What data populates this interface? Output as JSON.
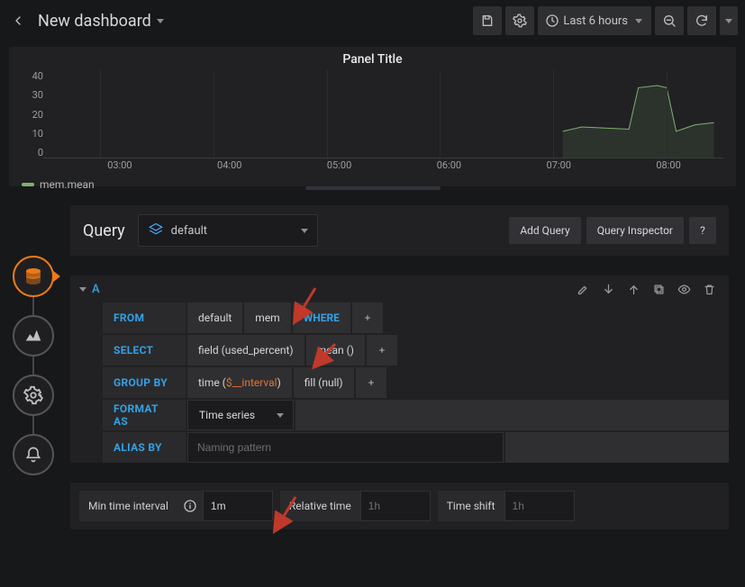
{
  "header": {
    "title": "New dashboard",
    "time_range": "Last 6 hours"
  },
  "panel": {
    "title": "Panel Title",
    "legend": "mem.mean"
  },
  "chart_data": {
    "type": "line",
    "title": "Panel Title",
    "xlabel": "",
    "ylabel": "",
    "ylim": [
      0,
      40
    ],
    "x_ticks": [
      "03:00",
      "04:00",
      "05:00",
      "06:00",
      "07:00",
      "08:00"
    ],
    "y_ticks": [
      0,
      10,
      20,
      30,
      40
    ],
    "series": [
      {
        "name": "mem.mean",
        "color": "#7eb26d",
        "x_range": [
          "02:30",
          "08:30"
        ],
        "points": [
          {
            "x": "07:05",
            "y": 12
          },
          {
            "x": "07:15",
            "y": 14
          },
          {
            "x": "07:40",
            "y": 13
          },
          {
            "x": "07:45",
            "y": 32
          },
          {
            "x": "07:55",
            "y": 33
          },
          {
            "x": "08:00",
            "y": 32
          },
          {
            "x": "08:05",
            "y": 12
          },
          {
            "x": "08:15",
            "y": 15
          },
          {
            "x": "08:25",
            "y": 16
          }
        ]
      }
    ]
  },
  "sidebar": {
    "items": [
      {
        "id": "datasource",
        "label": "datasource-icon"
      },
      {
        "id": "viz",
        "label": "visualization-icon"
      },
      {
        "id": "settings",
        "label": "panel-settings-icon"
      },
      {
        "id": "alert",
        "label": "alert-icon"
      }
    ]
  },
  "query_head": {
    "title": "Query",
    "datasource": "default",
    "add_query": "Add Query",
    "inspector": "Query Inspector",
    "help": "?"
  },
  "rows": [
    {
      "id": "A",
      "from": {
        "kw": "FROM",
        "policy": "default",
        "measurement": "mem",
        "where_kw": "WHERE"
      },
      "select": {
        "kw": "SELECT",
        "field": "field (used_percent)",
        "agg": "mean ()"
      },
      "group": {
        "kw": "GROUP BY",
        "time_pre": "time (",
        "time_var": "$__interval",
        "time_post": ")",
        "fill": "fill (null)"
      },
      "format": {
        "kw": "FORMAT AS",
        "value": "Time series"
      },
      "alias": {
        "kw": "ALIAS BY",
        "placeholder": "Naming pattern"
      }
    }
  ],
  "footer": {
    "min_interval_label": "Min time interval",
    "min_interval_value": "1m",
    "relative_label": "Relative time",
    "relative_placeholder": "1h",
    "shift_label": "Time shift",
    "shift_placeholder": "1h"
  }
}
